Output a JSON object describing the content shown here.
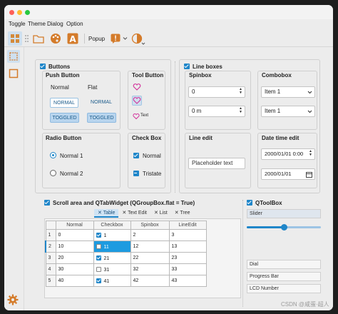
{
  "menu": [
    "Toggle",
    "Theme",
    "Dialog",
    "Option"
  ],
  "toolbar": {
    "popup_label": "Popup"
  },
  "buttons_group": {
    "title": "Buttons",
    "push_button": {
      "title": "Push Button",
      "normal": "Normal",
      "flat": "Flat",
      "btn_normal_1": "NORMAL",
      "btn_normal_2": "NORMAL",
      "btn_toggled_1": "TOGGLED",
      "btn_toggled_2": "TOGGLED"
    },
    "tool_button": {
      "title": "Tool Button",
      "text_label": "Text"
    },
    "radio_button": {
      "title": "Radio Button",
      "opt1": "Normal 1",
      "opt2": "Normal 2"
    },
    "check_box": {
      "title": "Check Box",
      "normal": "Normal",
      "tristate": "Tristate"
    }
  },
  "line_boxes_group": {
    "title": "Line boxes",
    "spinbox": {
      "title": "Spinbox",
      "val1": "0",
      "val2": "0 m"
    },
    "combobox": {
      "title": "Combobox",
      "val1": "Item 1",
      "val2": "Item 1"
    },
    "line_edit": {
      "title": "Line edit",
      "placeholder": "Placeholder text"
    },
    "date_time_edit": {
      "title": "Date time edit",
      "val1": "2000/01/01 0:00",
      "val2": "2000/01/01"
    }
  },
  "scroll_group": {
    "title": "Scroll area and QTabWidget (QGroupBox.flat = True)",
    "tabs": [
      {
        "label": "Table",
        "active": true
      },
      {
        "label": "Text Edit",
        "active": false
      },
      {
        "label": "List",
        "active": false
      },
      {
        "label": "Tree",
        "active": false
      }
    ],
    "table": {
      "headers": [
        "Normal",
        "Checkbox",
        "Spinbox",
        "LineEdit"
      ],
      "rows": [
        {
          "rh": "1",
          "normal": "0",
          "checked": true,
          "checkbox": "1",
          "spinbox": "2",
          "lineedit": "3"
        },
        {
          "rh": "2",
          "normal": "10",
          "checked": false,
          "checkbox": "11",
          "spinbox": "12",
          "lineedit": "13"
        },
        {
          "rh": "3",
          "normal": "20",
          "checked": true,
          "checkbox": "21",
          "spinbox": "22",
          "lineedit": "23"
        },
        {
          "rh": "4",
          "normal": "30",
          "checked": false,
          "checkbox": "31",
          "spinbox": "32",
          "lineedit": "33"
        },
        {
          "rh": "5",
          "normal": "40",
          "checked": true,
          "checkbox": "41",
          "spinbox": "42",
          "lineedit": "43"
        }
      ]
    }
  },
  "qtoolbox_group": {
    "title": "QToolBox",
    "items": [
      "Slider",
      "Dial",
      "Progress Bar",
      "LCD Number"
    ],
    "slider_value": 0.5
  },
  "watermark": "CSDN @咸蛋·超人",
  "colors": {
    "accent": "#1f86c9",
    "selection": "#1d9be0"
  }
}
